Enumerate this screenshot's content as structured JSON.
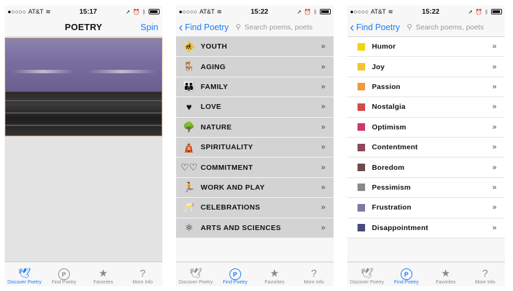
{
  "status": {
    "carrier": "AT&T",
    "signal": "●○○○○"
  },
  "screens": [
    {
      "time": "15:17",
      "title": "POETRY",
      "right_action": "Spin"
    },
    {
      "time": "15:22",
      "back": "Find Poetry",
      "search_placeholder": "Search poems, poets",
      "rows": [
        {
          "icon": "child-icon",
          "glyph": "🚸",
          "label": "YOUTH"
        },
        {
          "icon": "rocking-chair-icon",
          "glyph": "🪑",
          "label": "AGING"
        },
        {
          "icon": "family-icon",
          "glyph": "👪",
          "label": "FAMILY"
        },
        {
          "icon": "heart-icon",
          "glyph": "♥",
          "label": "LOVE"
        },
        {
          "icon": "tree-icon",
          "glyph": "🌳",
          "label": "NATURE"
        },
        {
          "icon": "temple-icon",
          "glyph": "🛕",
          "label": "SPIRITUALITY"
        },
        {
          "icon": "rings-icon",
          "glyph": "♡♡",
          "label": "COMMITMENT"
        },
        {
          "icon": "runner-icon",
          "glyph": "🏃",
          "label": "WORK AND PLAY"
        },
        {
          "icon": "champagne-icon",
          "glyph": "🥂",
          "label": "CELEBRATIONS"
        },
        {
          "icon": "atom-icon",
          "glyph": "⚛",
          "label": "ARTS AND SCIENCES"
        }
      ]
    },
    {
      "time": "15:22",
      "back": "Find Poetry",
      "search_placeholder": "Search poems, poets",
      "rows": [
        {
          "label": "Humor",
          "color": "#f2d40f"
        },
        {
          "label": "Joy",
          "color": "#f2c52e"
        },
        {
          "label": "Passion",
          "color": "#f19a3e"
        },
        {
          "label": "Nostalgia",
          "color": "#d24a4a"
        },
        {
          "label": "Optimism",
          "color": "#cc3a6a"
        },
        {
          "label": "Contentment",
          "color": "#8a4a5a"
        },
        {
          "label": "Boredom",
          "color": "#6a4a4a"
        },
        {
          "label": "Pessimism",
          "color": "#8a8a8a"
        },
        {
          "label": "Frustration",
          "color": "#7a7aa6"
        },
        {
          "label": "Disappointment",
          "color": "#4a4a7a"
        }
      ]
    }
  ],
  "row_arrow": "»",
  "tabs": [
    {
      "label": "Discover Poetry",
      "icon": "bird-icon",
      "glyph": "🕊"
    },
    {
      "label": "Find Poetry",
      "icon": "find-poetry-icon",
      "glyph": "P"
    },
    {
      "label": "Favorites",
      "icon": "favorites-folder-icon",
      "glyph": "★"
    },
    {
      "label": "More Info",
      "icon": "question-icon",
      "glyph": "?"
    }
  ]
}
